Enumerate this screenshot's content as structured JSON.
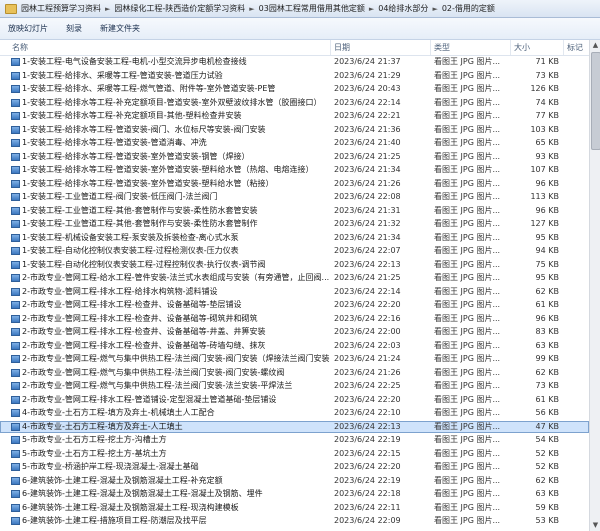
{
  "breadcrumb": [
    "园林工程预算学习资料",
    "园林绿化工程-陕西造价定额学习资料",
    "03园林工程常用借用其他定额",
    "04给排水部分",
    "02-借用的定额"
  ],
  "toolbar": {
    "slideshow": "放映幻灯片",
    "burn": "刻录",
    "new_folder": "新建文件夹"
  },
  "columns": {
    "name": "名称",
    "date": "日期",
    "type": "类型",
    "size": "大小",
    "tag": "标记"
  },
  "rows": [
    {
      "name": "1-安装工程-电气设备安装工程-电机-小型交流异步电机检查接线",
      "date": "2023/6/24 21:37",
      "type": "看图王 JPG 图片...",
      "size": "71 KB"
    },
    {
      "name": "1-安装工程-给排水、采暖等工程-管道安装-管道压力试验",
      "date": "2023/6/24 21:29",
      "type": "看图王 JPG 图片...",
      "size": "73 KB"
    },
    {
      "name": "1-安装工程-给排水、采暖等工程-燃气管道、附件等-室外管道安装-PE管",
      "date": "2023/6/24 20:43",
      "type": "看图王 JPG 图片...",
      "size": "126 KB"
    },
    {
      "name": "1-安装工程-给排水等工程-补充定额项目-管道安装-室外双壁波纹排水管（胶圈接口）",
      "date": "2023/6/24 22:14",
      "type": "看图王 JPG 图片...",
      "size": "74 KB"
    },
    {
      "name": "1-安装工程-给排水等工程-补充定额项目-其他-塑料检查井安装",
      "date": "2023/6/24 22:21",
      "type": "看图王 JPG 图片...",
      "size": "77 KB"
    },
    {
      "name": "1-安装工程-给排水等工程-管道安装-阀门、水位标尺等安装-阀门安装",
      "date": "2023/6/24 21:36",
      "type": "看图王 JPG 图片...",
      "size": "103 KB"
    },
    {
      "name": "1-安装工程-给排水等工程-管道安装-管道消毒、冲洗",
      "date": "2023/6/24 21:40",
      "type": "看图王 JPG 图片...",
      "size": "65 KB"
    },
    {
      "name": "1-安装工程-给排水等工程-管道安装-室外管道安装-钢管（焊接）",
      "date": "2023/6/24 21:25",
      "type": "看图王 JPG 图片...",
      "size": "93 KB"
    },
    {
      "name": "1-安装工程-给排水等工程-管道安装-室外管道安装-塑料给水管（热熔、电熔连接）",
      "date": "2023/6/24 21:34",
      "type": "看图王 JPG 图片...",
      "size": "107 KB"
    },
    {
      "name": "1-安装工程-给排水等工程-管道安装-室外管道安装-塑料给水管（粘接）",
      "date": "2023/6/24 21:26",
      "type": "看图王 JPG 图片...",
      "size": "96 KB"
    },
    {
      "name": "1-安装工程-工业管道工程-阀门安装-低压阀门-法兰阀门",
      "date": "2023/6/24 22:08",
      "type": "看图王 JPG 图片...",
      "size": "113 KB"
    },
    {
      "name": "1-安装工程-工业管道工程-其他-套管制作与安装-柔性防水套管安装",
      "date": "2023/6/24 21:31",
      "type": "看图王 JPG 图片...",
      "size": "96 KB"
    },
    {
      "name": "1-安装工程-工业管道工程-其他-套管制作与安装-柔性防水套管制作",
      "date": "2023/6/24 21:32",
      "type": "看图王 JPG 图片...",
      "size": "127 KB"
    },
    {
      "name": "1-安装工程-机械设备安装工程-泵安装及拆装检查-离心式水泵",
      "date": "2023/6/24 21:34",
      "type": "看图王 JPG 图片...",
      "size": "95 KB"
    },
    {
      "name": "1-安装工程-自动化控制仪表安装工程-过程检测仪表-压力仪表",
      "date": "2023/6/24 22:07",
      "type": "看图王 JPG 图片...",
      "size": "94 KB"
    },
    {
      "name": "1-安装工程-自动化控制仪表安装工程-过程控制仪表-执行仪表-调节阀",
      "date": "2023/6/24 22:13",
      "type": "看图王 JPG 图片...",
      "size": "75 KB"
    },
    {
      "name": "2-市政专业-管网工程-给水工程-管件安装-法兰式水表组成与安装（有旁通管，止回阀...",
      "date": "2023/6/24 21:25",
      "type": "看图王 JPG 图片...",
      "size": "95 KB"
    },
    {
      "name": "2-市政专业-管网工程-排水工程-给排水构筑物-滤料铺设",
      "date": "2023/6/24 22:14",
      "type": "看图王 JPG 图片...",
      "size": "62 KB"
    },
    {
      "name": "2-市政专业-管网工程-排水工程-检查井、设备基础等-垫层铺设",
      "date": "2023/6/24 22:20",
      "type": "看图王 JPG 图片...",
      "size": "61 KB"
    },
    {
      "name": "2-市政专业-管网工程-排水工程-检查井、设备基础等-砌筑井和砌筑",
      "date": "2023/6/24 22:16",
      "type": "看图王 JPG 图片...",
      "size": "96 KB"
    },
    {
      "name": "2-市政专业-管网工程-排水工程-检查井、设备基础等-井盖、井箅安装",
      "date": "2023/6/24 22:00",
      "type": "看图王 JPG 图片...",
      "size": "83 KB"
    },
    {
      "name": "2-市政专业-管网工程-排水工程-检查井、设备基础等-砖墙勾缝、抹灰",
      "date": "2023/6/24 22:03",
      "type": "看图王 JPG 图片...",
      "size": "63 KB"
    },
    {
      "name": "2-市政专业-管网工程-燃气与集中供热工程-法兰阀门安装-阀门安装（焊接法兰阀门安装",
      "date": "2023/6/24 21:24",
      "type": "看图王 JPG 图片...",
      "size": "99 KB"
    },
    {
      "name": "2-市政专业-管网工程-燃气与集中供热工程-法兰阀门安装-阀门安装-螺纹阀",
      "date": "2023/6/24 21:26",
      "type": "看图王 JPG 图片...",
      "size": "62 KB"
    },
    {
      "name": "2-市政专业-管网工程-燃气与集中供热工程-法兰阀门安装-法兰安装-平焊法兰",
      "date": "2023/6/24 22:25",
      "type": "看图王 JPG 图片...",
      "size": "73 KB"
    },
    {
      "name": "2-市政专业-管网工程-排水工程-管道铺设-定型混凝土管道基础-垫层铺设",
      "date": "2023/6/24 22:20",
      "type": "看图王 JPG 图片...",
      "size": "61 KB"
    },
    {
      "name": "4-市政专业-土石方工程-填方及弃土-机械填土人工配合",
      "date": "2023/6/24 22:10",
      "type": "看图王 JPG 图片...",
      "size": "56 KB"
    },
    {
      "name": "4-市政专业-土石方工程-填方及弃土-人工填土",
      "date": "2023/6/24 22:13",
      "type": "看图王 JPG 图片...",
      "size": "47 KB"
    },
    {
      "name": "5-市政专业-土石方工程-挖土方-沟槽土方",
      "date": "2023/6/24 22:19",
      "type": "看图王 JPG 图片...",
      "size": "54 KB"
    },
    {
      "name": "5-市政专业-土石方工程-挖土方-基坑土方",
      "date": "2023/6/24 22:15",
      "type": "看图王 JPG 图片...",
      "size": "52 KB"
    },
    {
      "name": "5-市政专业-桥涵护岸工程-现浇混凝土-混凝土基础",
      "date": "2023/6/24 22:20",
      "type": "看图王 JPG 图片...",
      "size": "52 KB"
    },
    {
      "name": "6-建筑装饰-土建工程-混凝土及钢筋混凝土工程-补充定额",
      "date": "2023/6/24 22:19",
      "type": "看图王 JPG 图片...",
      "size": "62 KB"
    },
    {
      "name": "6-建筑装饰-土建工程-混凝土及钢筋混凝土工程-混凝土及钢筋、埋件",
      "date": "2023/6/24 22:18",
      "type": "看图王 JPG 图片...",
      "size": "63 KB"
    },
    {
      "name": "6-建筑装饰-土建工程-混凝土及钢筋混凝土工程-现浇构建模板",
      "date": "2023/6/24 22:11",
      "type": "看图王 JPG 图片...",
      "size": "59 KB"
    },
    {
      "name": "6-建筑装饰-土建工程-措施项目工程-防潮层及找平层",
      "date": "2023/6/24 22:09",
      "type": "看图王 JPG 图片...",
      "size": "53 KB"
    }
  ],
  "selected_row": 27
}
